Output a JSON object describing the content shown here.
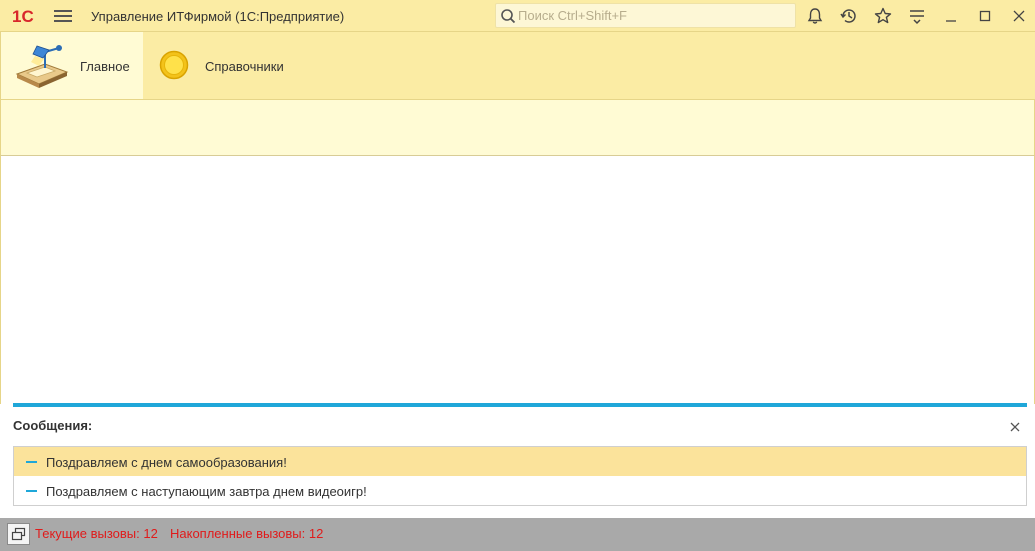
{
  "titlebar": {
    "logo": "1С",
    "app_title": "Управление ИТФирмой  (1С:Предприятие)",
    "search_placeholder": "Поиск Ctrl+Shift+F",
    "icons": [
      "bell-icon",
      "history-icon",
      "star-icon",
      "settings-lines-icon",
      "minimize-icon",
      "maximize-icon",
      "close-icon"
    ]
  },
  "sections": [
    {
      "label": "Главное",
      "icon": "desk-lamp-icon",
      "active": true
    },
    {
      "label": "Справочники",
      "icon": "yellow-circle-icon",
      "active": false
    }
  ],
  "messages": {
    "title": "Сообщения:",
    "items": [
      {
        "text": "Поздравляем с днем самообразования!",
        "selected": true
      },
      {
        "text": "Поздравляем с наступающим завтра днем видеоигр!",
        "selected": false
      }
    ]
  },
  "status": {
    "current_calls": "Текущие вызовы: 12",
    "accumulated_calls": "Накопленные вызовы: 12"
  },
  "colors": {
    "header_bg": "#fbeca4",
    "active_section_bg": "#fffbd4",
    "accent_blue": "#1fa7d9",
    "selected_row": "#fbe39b",
    "status_red": "#e01b1b"
  }
}
